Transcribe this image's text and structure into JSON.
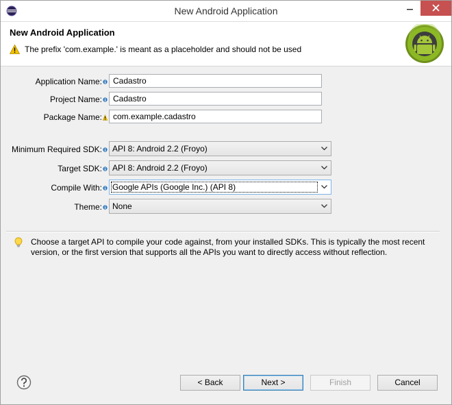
{
  "window": {
    "title": "New Android Application"
  },
  "header": {
    "title": "New Android Application",
    "warning": "The prefix 'com.example.' is meant as a placeholder and should not be used"
  },
  "form": {
    "application_name": {
      "label": "Application Name:",
      "value": "Cadastro"
    },
    "project_name": {
      "label": "Project Name:",
      "value": "Cadastro"
    },
    "package_name": {
      "label": "Package Name:",
      "value": "com.example.cadastro"
    },
    "min_sdk": {
      "label": "Minimum Required SDK:",
      "value": "API 8: Android 2.2 (Froyo)"
    },
    "target_sdk": {
      "label": "Target SDK:",
      "value": "API 8: Android 2.2 (Froyo)"
    },
    "compile_with": {
      "label": "Compile With:",
      "value": "Google APIs (Google Inc.) (API 8)"
    },
    "theme": {
      "label": "Theme:",
      "value": "None"
    }
  },
  "tip": "Choose a target API to compile your code against, from your installed SDKs. This is typically the most recent version, or the first version that supports all the APIs you want to directly access without reflection.",
  "buttons": {
    "back": "< Back",
    "next": "Next >",
    "finish": "Finish",
    "cancel": "Cancel"
  },
  "colors": {
    "close_button": "#c75050",
    "warning": "#f2c200",
    "info": "#3a7fc1",
    "android": "#97c024"
  }
}
